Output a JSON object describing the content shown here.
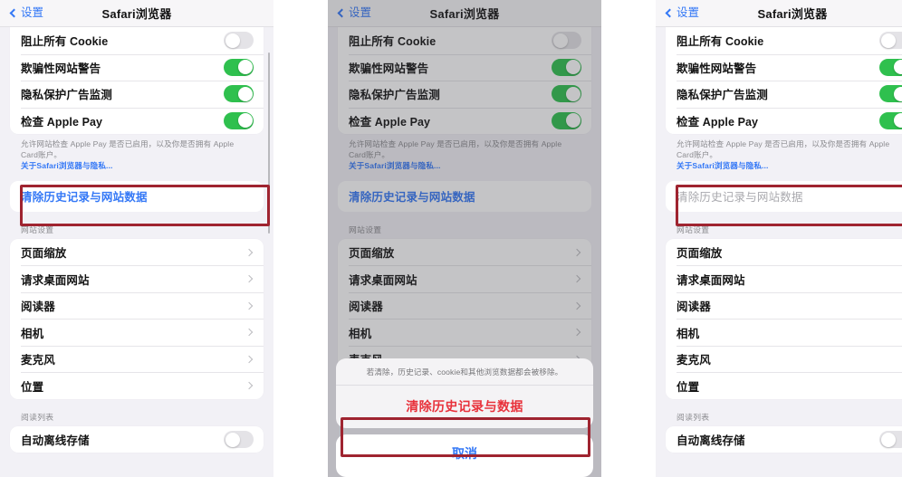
{
  "nav": {
    "back_label": "设置",
    "title": "Safari浏览器",
    "back_icon": "chevron-left-icon"
  },
  "toggles_section": {
    "rows": [
      {
        "label": "阻止所有 Cookie",
        "state": "off"
      },
      {
        "label": "欺骗性网站警告",
        "state": "on"
      },
      {
        "label": "隐私保护广告监测",
        "state": "on"
      },
      {
        "label": "检查 Apple Pay",
        "state": "on"
      }
    ]
  },
  "footnote": {
    "text": "允许网站检查 Apple Pay 是否已启用，以及你是否拥有 Apple Card账户。",
    "link": "关于Safari浏览器与隐私..."
  },
  "clear_history": {
    "label": "清除历史记录与网站数据",
    "state_enabled": "enabled",
    "state_disabled": "disabled"
  },
  "site_settings": {
    "header": "网站设置",
    "rows": [
      {
        "label": "页面缩放"
      },
      {
        "label": "请求桌面网站"
      },
      {
        "label": "阅读器"
      },
      {
        "label": "相机"
      },
      {
        "label": "麦克风"
      },
      {
        "label": "位置"
      }
    ]
  },
  "reading_list": {
    "header": "阅读列表",
    "row": {
      "label": "自动离线存储",
      "state": "off"
    }
  },
  "action_sheet": {
    "message": "若清除，历史记录、cookie和其他浏览数据都会被移除。",
    "destructive": "清除历史记录与数据",
    "cancel": "取消"
  },
  "colors": {
    "accent_blue": "#3478f6",
    "toggle_on_green": "#2fc04e",
    "destructive_red": "#e8313b",
    "annotation_red": "#9f2430",
    "page_background": "#f2f1f6"
  }
}
